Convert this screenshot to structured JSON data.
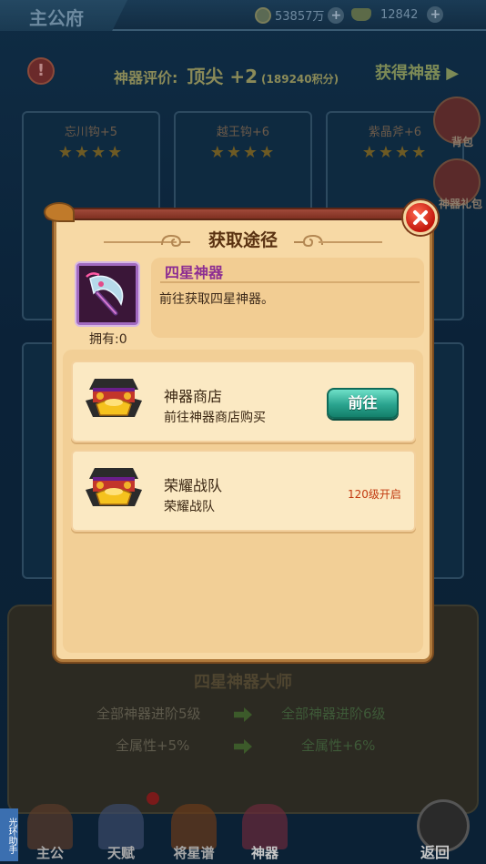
{
  "header": {
    "title": "主公府",
    "silver": "53857万",
    "gold": "12842"
  },
  "rating": {
    "label": "神器评价:",
    "value": "顶尖 +2",
    "points": "(189240积分)",
    "get_label": "获得神器"
  },
  "cards": [
    {
      "name": "忘川钩+5"
    },
    {
      "name": "越王钩+6"
    },
    {
      "name": "紫晶斧+6"
    }
  ],
  "side": {
    "bag": "背包",
    "gift": "神器礼包"
  },
  "master": {
    "title": "四星神器大师",
    "rows": [
      {
        "current": "全部神器进阶5级",
        "next": "全部神器进阶6级"
      },
      {
        "current": "全属性+5%",
        "next": "全属性+6%"
      }
    ]
  },
  "nav": {
    "items": [
      "主公",
      "天赋",
      "将星谱",
      "神器"
    ],
    "back": "返回",
    "helper": "光环助手"
  },
  "modal": {
    "title": "获取途径",
    "item": {
      "name": "四星神器",
      "desc": "前往获取四星神器。",
      "owned": "拥有:0"
    },
    "routes": [
      {
        "name": "神器商店",
        "sub": "前往神器商店购买",
        "button": "前往"
      },
      {
        "name": "荣耀战队",
        "sub": "荣耀战队",
        "lock": "120级开启"
      }
    ]
  }
}
